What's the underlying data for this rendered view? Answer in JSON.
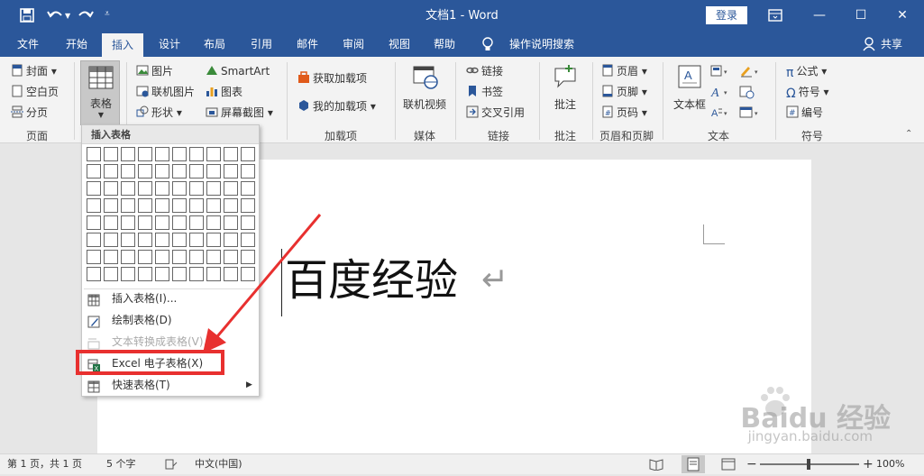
{
  "titlebar": {
    "doc_title": "文档1 - Word",
    "login": "登录"
  },
  "tabs": [
    "文件",
    "开始",
    "插入",
    "设计",
    "布局",
    "引用",
    "邮件",
    "审阅",
    "视图",
    "帮助"
  ],
  "tell_me": "操作说明搜索",
  "share": "共享",
  "ribbon": {
    "pages": {
      "cover": "封面",
      "blank": "空白页",
      "break": "分页",
      "group": "页面"
    },
    "table": {
      "label": "表格"
    },
    "illustrations": {
      "picture": "图片",
      "online_picture": "联机图片",
      "shapes": "形状",
      "smartart": "SmartArt",
      "chart": "图表",
      "screenshot": "屏幕截图"
    },
    "addins": {
      "get": "获取加载项",
      "my": "我的加载项",
      "group": "加载项"
    },
    "media": {
      "online_video": "联机视频",
      "group": "媒体"
    },
    "links": {
      "link": "链接",
      "bookmark": "书签",
      "crossref": "交叉引用",
      "group": "链接"
    },
    "comments": {
      "comment": "批注",
      "group": "批注"
    },
    "header_footer": {
      "header": "页眉",
      "footer": "页脚",
      "page_number": "页码",
      "group": "页眉和页脚"
    },
    "text": {
      "textbox": "文本框",
      "group": "文本"
    },
    "symbols": {
      "equation": "公式",
      "symbol": "符号",
      "number": "编号",
      "group": "符号"
    }
  },
  "dropdown": {
    "header": "插入表格",
    "items": [
      "插入表格(I)...",
      "绘制表格(D)",
      "文本转换成表格(V)...",
      "Excel 电子表格(X)",
      "快速表格(T)"
    ]
  },
  "document": {
    "text": "百度经验",
    "para_mark": "↵"
  },
  "status": {
    "page": "第 1 页，共 1 页",
    "words": "5 个字",
    "lang": "中文(中国)",
    "zoom": "100%"
  },
  "watermark": {
    "brand": "Baidu 经验",
    "url": "jingyan.baidu.com"
  },
  "colors": {
    "accent": "#2b579a",
    "highlight_box": "#e8302f",
    "arrow": "#e8302f"
  }
}
